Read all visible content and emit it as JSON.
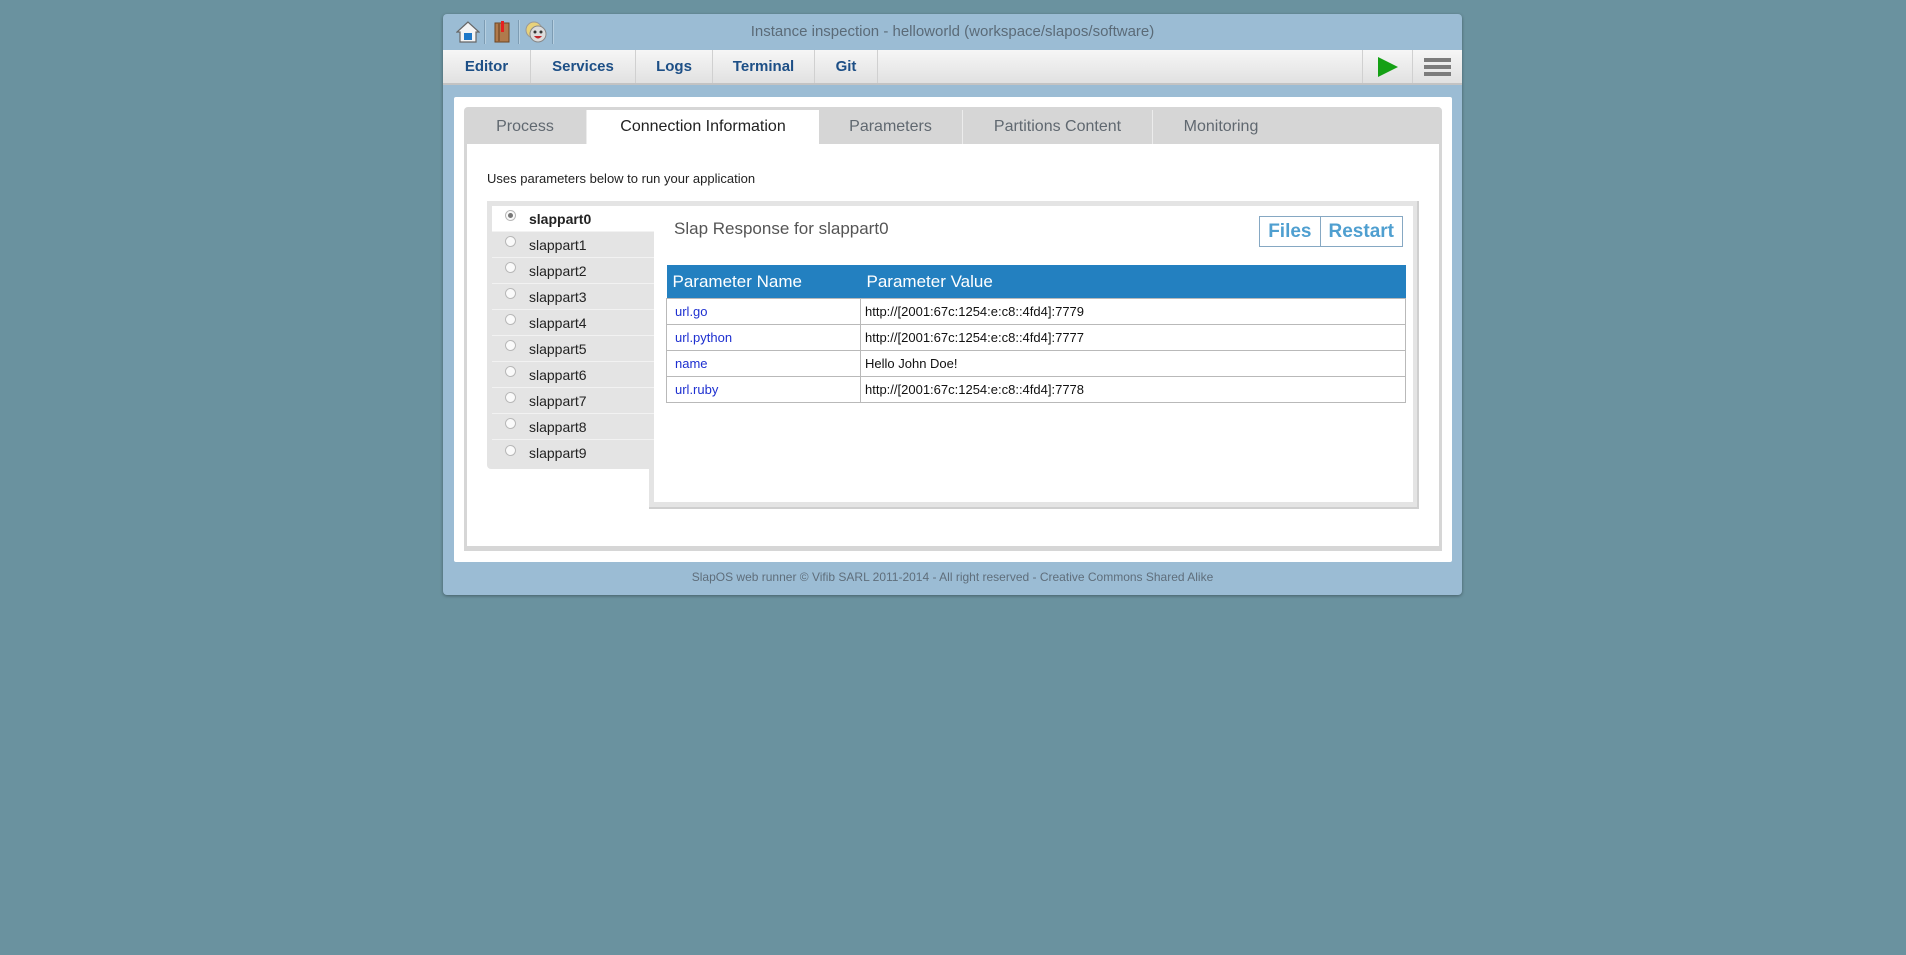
{
  "window": {
    "title": "Instance inspection - helloworld (workspace/slapos/software)",
    "title_icons": [
      "home-icon",
      "book-icon",
      "smiley-icon"
    ]
  },
  "nav": {
    "items": [
      {
        "label": "Editor"
      },
      {
        "label": "Services"
      },
      {
        "label": "Logs"
      },
      {
        "label": "Terminal"
      },
      {
        "label": "Git"
      }
    ],
    "right_buttons": [
      "play-icon",
      "menu-icon"
    ]
  },
  "tabs": [
    {
      "label": "Process",
      "active": false
    },
    {
      "label": "Connection Information",
      "active": true
    },
    {
      "label": "Parameters",
      "active": false
    },
    {
      "label": "Partitions Content",
      "active": false
    },
    {
      "label": "Monitoring",
      "active": false
    }
  ],
  "content": {
    "description": "Uses parameters below to run your application",
    "partitions": [
      {
        "label": "slappart0",
        "selected": true
      },
      {
        "label": "slappart1",
        "selected": false
      },
      {
        "label": "slappart2",
        "selected": false
      },
      {
        "label": "slappart3",
        "selected": false
      },
      {
        "label": "slappart4",
        "selected": false
      },
      {
        "label": "slappart5",
        "selected": false
      },
      {
        "label": "slappart6",
        "selected": false
      },
      {
        "label": "slappart7",
        "selected": false
      },
      {
        "label": "slappart8",
        "selected": false
      },
      {
        "label": "slappart9",
        "selected": false
      }
    ],
    "response_title": "Slap Response for slappart0",
    "files_label": "Files",
    "restart_label": "Restart",
    "table": {
      "headers": [
        "Parameter Name",
        "Parameter Value"
      ],
      "rows": [
        {
          "name": "url.go",
          "value": "http://[2001:67c:1254:e:c8::4fd4]:7779"
        },
        {
          "name": "url.python",
          "value": "http://[2001:67c:1254:e:c8::4fd4]:7777"
        },
        {
          "name": "name",
          "value": "Hello John Doe!"
        },
        {
          "name": "url.ruby",
          "value": "http://[2001:67c:1254:e:c8::4fd4]:7778"
        }
      ]
    }
  },
  "footer": {
    "text": "SlapOS web runner © Vifib SARL 2011-2014 - All right reserved - Creative Commons Shared Alike"
  },
  "colors": {
    "background": "#6a929f",
    "frame": "#9bbcd4",
    "nav_text": "#1d4f86",
    "table_header": "#2380c0",
    "param_link": "#1d2fd0",
    "action_button": "#4f9fd0",
    "play": "#14a014"
  }
}
